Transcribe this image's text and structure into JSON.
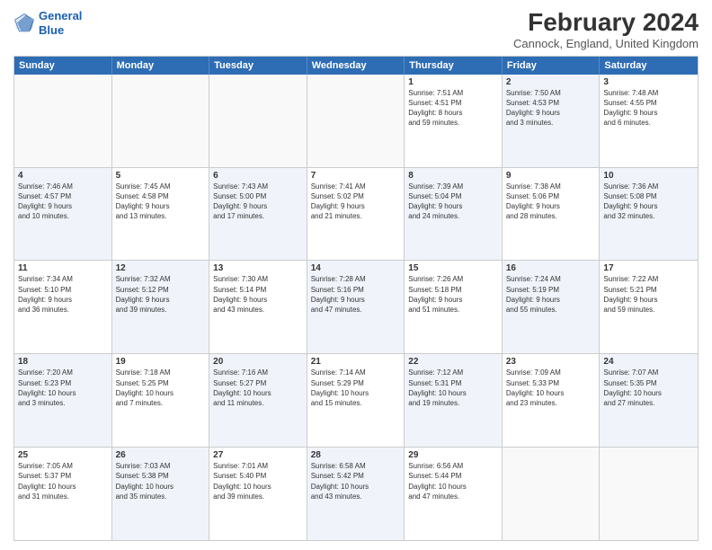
{
  "logo": {
    "line1": "General",
    "line2": "Blue"
  },
  "title": "February 2024",
  "location": "Cannock, England, United Kingdom",
  "headers": [
    "Sunday",
    "Monday",
    "Tuesday",
    "Wednesday",
    "Thursday",
    "Friday",
    "Saturday"
  ],
  "rows": [
    [
      {
        "day": "",
        "text": "",
        "empty": true
      },
      {
        "day": "",
        "text": "",
        "empty": true
      },
      {
        "day": "",
        "text": "",
        "empty": true
      },
      {
        "day": "",
        "text": "",
        "empty": true
      },
      {
        "day": "1",
        "text": "Sunrise: 7:51 AM\nSunset: 4:51 PM\nDaylight: 8 hours\nand 59 minutes.",
        "empty": false
      },
      {
        "day": "2",
        "text": "Sunrise: 7:50 AM\nSunset: 4:53 PM\nDaylight: 9 hours\nand 3 minutes.",
        "empty": false,
        "alt": true
      },
      {
        "day": "3",
        "text": "Sunrise: 7:48 AM\nSunset: 4:55 PM\nDaylight: 9 hours\nand 6 minutes.",
        "empty": false
      }
    ],
    [
      {
        "day": "4",
        "text": "Sunrise: 7:46 AM\nSunset: 4:57 PM\nDaylight: 9 hours\nand 10 minutes.",
        "empty": false,
        "alt": true
      },
      {
        "day": "5",
        "text": "Sunrise: 7:45 AM\nSunset: 4:58 PM\nDaylight: 9 hours\nand 13 minutes.",
        "empty": false
      },
      {
        "day": "6",
        "text": "Sunrise: 7:43 AM\nSunset: 5:00 PM\nDaylight: 9 hours\nand 17 minutes.",
        "empty": false,
        "alt": true
      },
      {
        "day": "7",
        "text": "Sunrise: 7:41 AM\nSunset: 5:02 PM\nDaylight: 9 hours\nand 21 minutes.",
        "empty": false
      },
      {
        "day": "8",
        "text": "Sunrise: 7:39 AM\nSunset: 5:04 PM\nDaylight: 9 hours\nand 24 minutes.",
        "empty": false,
        "alt": true
      },
      {
        "day": "9",
        "text": "Sunrise: 7:38 AM\nSunset: 5:06 PM\nDaylight: 9 hours\nand 28 minutes.",
        "empty": false
      },
      {
        "day": "10",
        "text": "Sunrise: 7:36 AM\nSunset: 5:08 PM\nDaylight: 9 hours\nand 32 minutes.",
        "empty": false,
        "alt": true
      }
    ],
    [
      {
        "day": "11",
        "text": "Sunrise: 7:34 AM\nSunset: 5:10 PM\nDaylight: 9 hours\nand 36 minutes.",
        "empty": false
      },
      {
        "day": "12",
        "text": "Sunrise: 7:32 AM\nSunset: 5:12 PM\nDaylight: 9 hours\nand 39 minutes.",
        "empty": false,
        "alt": true
      },
      {
        "day": "13",
        "text": "Sunrise: 7:30 AM\nSunset: 5:14 PM\nDaylight: 9 hours\nand 43 minutes.",
        "empty": false
      },
      {
        "day": "14",
        "text": "Sunrise: 7:28 AM\nSunset: 5:16 PM\nDaylight: 9 hours\nand 47 minutes.",
        "empty": false,
        "alt": true
      },
      {
        "day": "15",
        "text": "Sunrise: 7:26 AM\nSunset: 5:18 PM\nDaylight: 9 hours\nand 51 minutes.",
        "empty": false
      },
      {
        "day": "16",
        "text": "Sunrise: 7:24 AM\nSunset: 5:19 PM\nDaylight: 9 hours\nand 55 minutes.",
        "empty": false,
        "alt": true
      },
      {
        "day": "17",
        "text": "Sunrise: 7:22 AM\nSunset: 5:21 PM\nDaylight: 9 hours\nand 59 minutes.",
        "empty": false
      }
    ],
    [
      {
        "day": "18",
        "text": "Sunrise: 7:20 AM\nSunset: 5:23 PM\nDaylight: 10 hours\nand 3 minutes.",
        "empty": false,
        "alt": true
      },
      {
        "day": "19",
        "text": "Sunrise: 7:18 AM\nSunset: 5:25 PM\nDaylight: 10 hours\nand 7 minutes.",
        "empty": false
      },
      {
        "day": "20",
        "text": "Sunrise: 7:16 AM\nSunset: 5:27 PM\nDaylight: 10 hours\nand 11 minutes.",
        "empty": false,
        "alt": true
      },
      {
        "day": "21",
        "text": "Sunrise: 7:14 AM\nSunset: 5:29 PM\nDaylight: 10 hours\nand 15 minutes.",
        "empty": false
      },
      {
        "day": "22",
        "text": "Sunrise: 7:12 AM\nSunset: 5:31 PM\nDaylight: 10 hours\nand 19 minutes.",
        "empty": false,
        "alt": true
      },
      {
        "day": "23",
        "text": "Sunrise: 7:09 AM\nSunset: 5:33 PM\nDaylight: 10 hours\nand 23 minutes.",
        "empty": false
      },
      {
        "day": "24",
        "text": "Sunrise: 7:07 AM\nSunset: 5:35 PM\nDaylight: 10 hours\nand 27 minutes.",
        "empty": false,
        "alt": true
      }
    ],
    [
      {
        "day": "25",
        "text": "Sunrise: 7:05 AM\nSunset: 5:37 PM\nDaylight: 10 hours\nand 31 minutes.",
        "empty": false
      },
      {
        "day": "26",
        "text": "Sunrise: 7:03 AM\nSunset: 5:38 PM\nDaylight: 10 hours\nand 35 minutes.",
        "empty": false,
        "alt": true
      },
      {
        "day": "27",
        "text": "Sunrise: 7:01 AM\nSunset: 5:40 PM\nDaylight: 10 hours\nand 39 minutes.",
        "empty": false
      },
      {
        "day": "28",
        "text": "Sunrise: 6:58 AM\nSunset: 5:42 PM\nDaylight: 10 hours\nand 43 minutes.",
        "empty": false,
        "alt": true
      },
      {
        "day": "29",
        "text": "Sunrise: 6:56 AM\nSunset: 5:44 PM\nDaylight: 10 hours\nand 47 minutes.",
        "empty": false
      },
      {
        "day": "",
        "text": "",
        "empty": true
      },
      {
        "day": "",
        "text": "",
        "empty": true
      }
    ]
  ]
}
